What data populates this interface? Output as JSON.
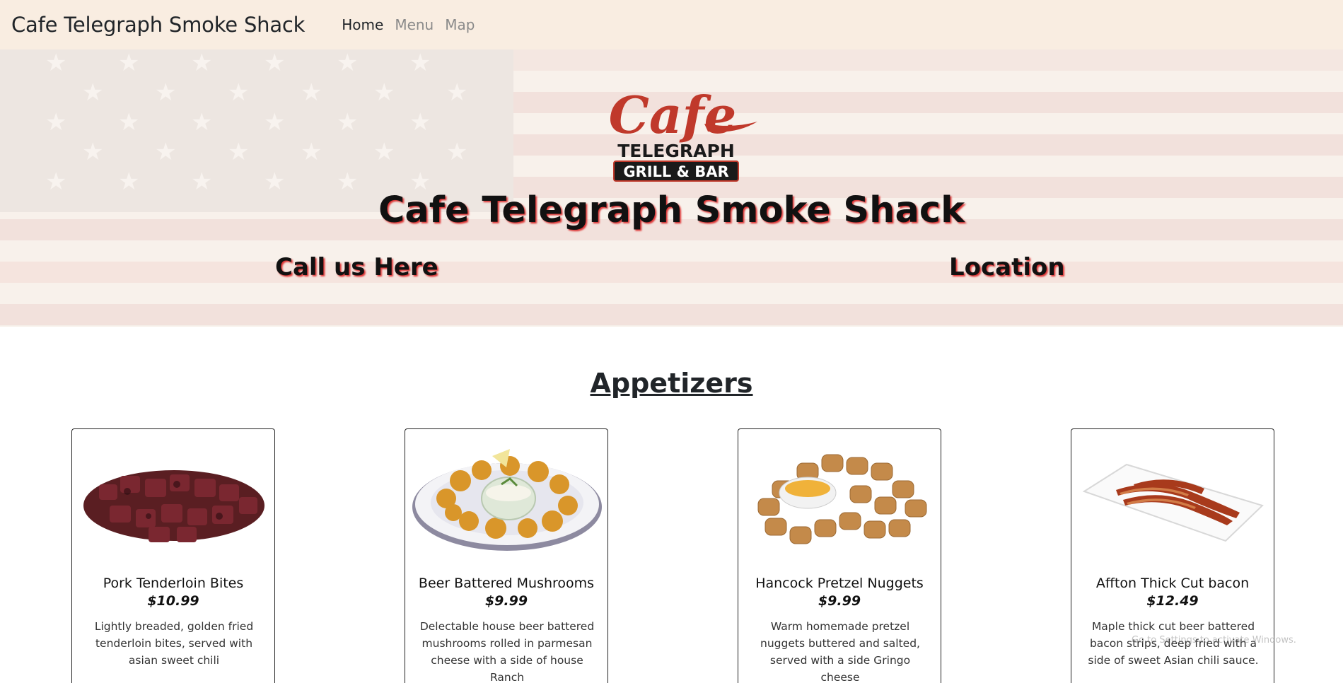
{
  "navbar": {
    "brand": "Cafe Telegraph Smoke Shack",
    "links": [
      {
        "label": "Home",
        "active": true
      },
      {
        "label": "Menu",
        "active": false
      },
      {
        "label": "Map",
        "active": false
      }
    ]
  },
  "hero": {
    "logo": {
      "word1": "Cafe",
      "word2": "TELEGRAPH",
      "word3": "GRILL & BAR"
    },
    "title": "Cafe Telegraph Smoke Shack",
    "call_label": "Call us Here",
    "location_label": "Location"
  },
  "section": {
    "title": "Appetizers"
  },
  "items": [
    {
      "name": "Pork Tenderloin Bites",
      "price": "$10.99",
      "desc": "Lightly breaded, golden fried tenderloin bites, served with asian sweet chili",
      "image": "pork-tenderloin-bites-photo"
    },
    {
      "name": "Beer Battered Mushrooms",
      "price": "$9.99",
      "desc": "Delectable house beer battered mushrooms rolled in parmesan cheese with a side of house Ranch",
      "image": "beer-battered-mushrooms-photo"
    },
    {
      "name": "Hancock Pretzel Nuggets",
      "price": "$9.99",
      "desc": "Warm homemade pretzel nuggets buttered and salted, served with a side Gringo cheese",
      "image": "pretzel-nuggets-photo"
    },
    {
      "name": "Affton Thick Cut bacon",
      "price": "$12.49",
      "desc": "Maple thick cut beer battered bacon strips, deep fried with a side of sweet Asian chili sauce.",
      "image": "thick-cut-bacon-photo"
    }
  ],
  "colors": {
    "navbar_bg": "#f9ede1",
    "accent_red": "#c0392b",
    "text_shadow": "#dd3333"
  },
  "os_watermark": "Go to Settings to activate Windows."
}
